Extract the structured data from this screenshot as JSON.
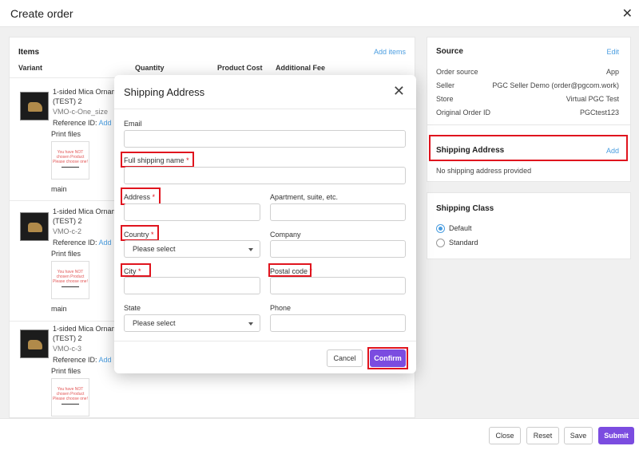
{
  "header": {
    "title": "Create order",
    "close_icon": "close-icon"
  },
  "items": {
    "title": "Items",
    "add_items": "Add items",
    "columns": [
      "Variant",
      "Quantity",
      "Product Cost",
      "Additional Fee"
    ],
    "rows": [
      {
        "name": "1-sided Mica Ornam (TEST) 2",
        "sku": "VMO-c-One_size",
        "ref_label": "Reference ID:",
        "ref_link": "Add",
        "print_files": "Print files",
        "pf_text": "You have NOT chosen Product Please choose one!",
        "main": "main"
      },
      {
        "name": "1-sided Mica Ornam (TEST) 2",
        "sku": "VMO-c-2",
        "ref_label": "Reference ID:",
        "ref_link": "Add",
        "print_files": "Print files",
        "pf_text": "You have NOT chosen Product Please choose one!",
        "main": "main"
      },
      {
        "name": "1-sided Mica Ornam (TEST) 2",
        "sku": "VMO-c-3",
        "ref_label": "Reference ID:",
        "ref_link": "Add",
        "print_files": "Print files",
        "pf_text": "You have NOT chosen Product Please choose one!"
      }
    ]
  },
  "source": {
    "title": "Source",
    "edit": "Edit",
    "fields": [
      {
        "k": "Order source",
        "v": "App"
      },
      {
        "k": "Seller",
        "v": "PGC Seller Demo (order@pgcom.work)"
      },
      {
        "k": "Store",
        "v": "Virtual PGC Test"
      },
      {
        "k": "Original Order ID",
        "v": "PGCtest123"
      }
    ]
  },
  "shipping_card": {
    "title": "Shipping Address",
    "add": "Add",
    "empty": "No shipping address provided"
  },
  "shipping_class": {
    "title": "Shipping Class",
    "options": [
      "Default",
      "Standard"
    ],
    "selected": "Default"
  },
  "modal": {
    "title": "Shipping Address",
    "email": "Email",
    "full_name": "Full shipping name",
    "address": "Address",
    "apartment": "Apartment, suite, etc.",
    "country": "Country",
    "country_placeholder": "Please select",
    "company": "Company",
    "city": "City",
    "postal": "Postal code",
    "state": "State",
    "state_placeholder": "Please select",
    "phone": "Phone",
    "required": "*",
    "cancel": "Cancel",
    "confirm": "Confirm"
  },
  "footer": {
    "close": "Close",
    "reset": "Reset",
    "save": "Save",
    "submit": "Submit"
  },
  "colors": {
    "accent": "#7b4ce0",
    "link": "#4a9de0",
    "highlight": "#e0141e"
  }
}
